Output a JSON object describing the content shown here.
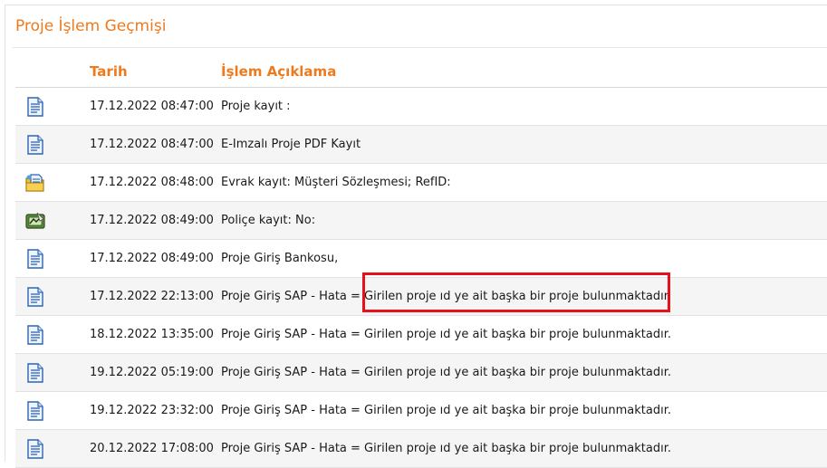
{
  "panel": {
    "title": "Proje İşlem Geçmişi"
  },
  "table": {
    "headers": {
      "date": "Tarih",
      "description": "İşlem Açıklama"
    },
    "rows": [
      {
        "icon": "document-icon",
        "date": "17.12.2022 08:47:00",
        "description": "Proje kayıt :"
      },
      {
        "icon": "document-icon",
        "date": "17.12.2022 08:47:00",
        "description": "E-Imzalı Proje PDF Kayıt"
      },
      {
        "icon": "folder-document-icon",
        "date": "17.12.2022 08:48:00",
        "description": "Evrak kayıt: Müşteri Sözleşmesi; RefID:"
      },
      {
        "icon": "signed-policy-icon",
        "date": "17.12.2022 08:49:00",
        "description": "Poliçe kayıt: No:"
      },
      {
        "icon": "document-icon",
        "date": "17.12.2022 08:49:00",
        "description": "Proje Giriş Bankosu,"
      },
      {
        "icon": "document-icon",
        "date": "17.12.2022 22:13:00",
        "description": "Proje Giriş SAP - Hata = Girilen proje ıd ye ait başka bir proje bulunmaktadır."
      },
      {
        "icon": "document-icon",
        "date": "18.12.2022 13:35:00",
        "description": "Proje Giriş SAP - Hata = Girilen proje ıd ye ait başka bir proje bulunmaktadır."
      },
      {
        "icon": "document-icon",
        "date": "19.12.2022 05:19:00",
        "description": "Proje Giriş SAP - Hata = Girilen proje ıd ye ait başka bir proje bulunmaktadır."
      },
      {
        "icon": "document-icon",
        "date": "19.12.2022 23:32:00",
        "description": "Proje Giriş SAP - Hata = Girilen proje ıd ye ait başka bir proje bulunmaktadır."
      },
      {
        "icon": "document-icon",
        "date": "20.12.2022 17:08:00",
        "description": "Proje Giriş SAP - Hata = Girilen proje ıd ye ait başka bir proje bulunmaktadır."
      }
    ]
  },
  "colors": {
    "accent": "#ee7a1e",
    "highlight_box": "#e8101a",
    "row_alt": "#f5f5f5"
  }
}
